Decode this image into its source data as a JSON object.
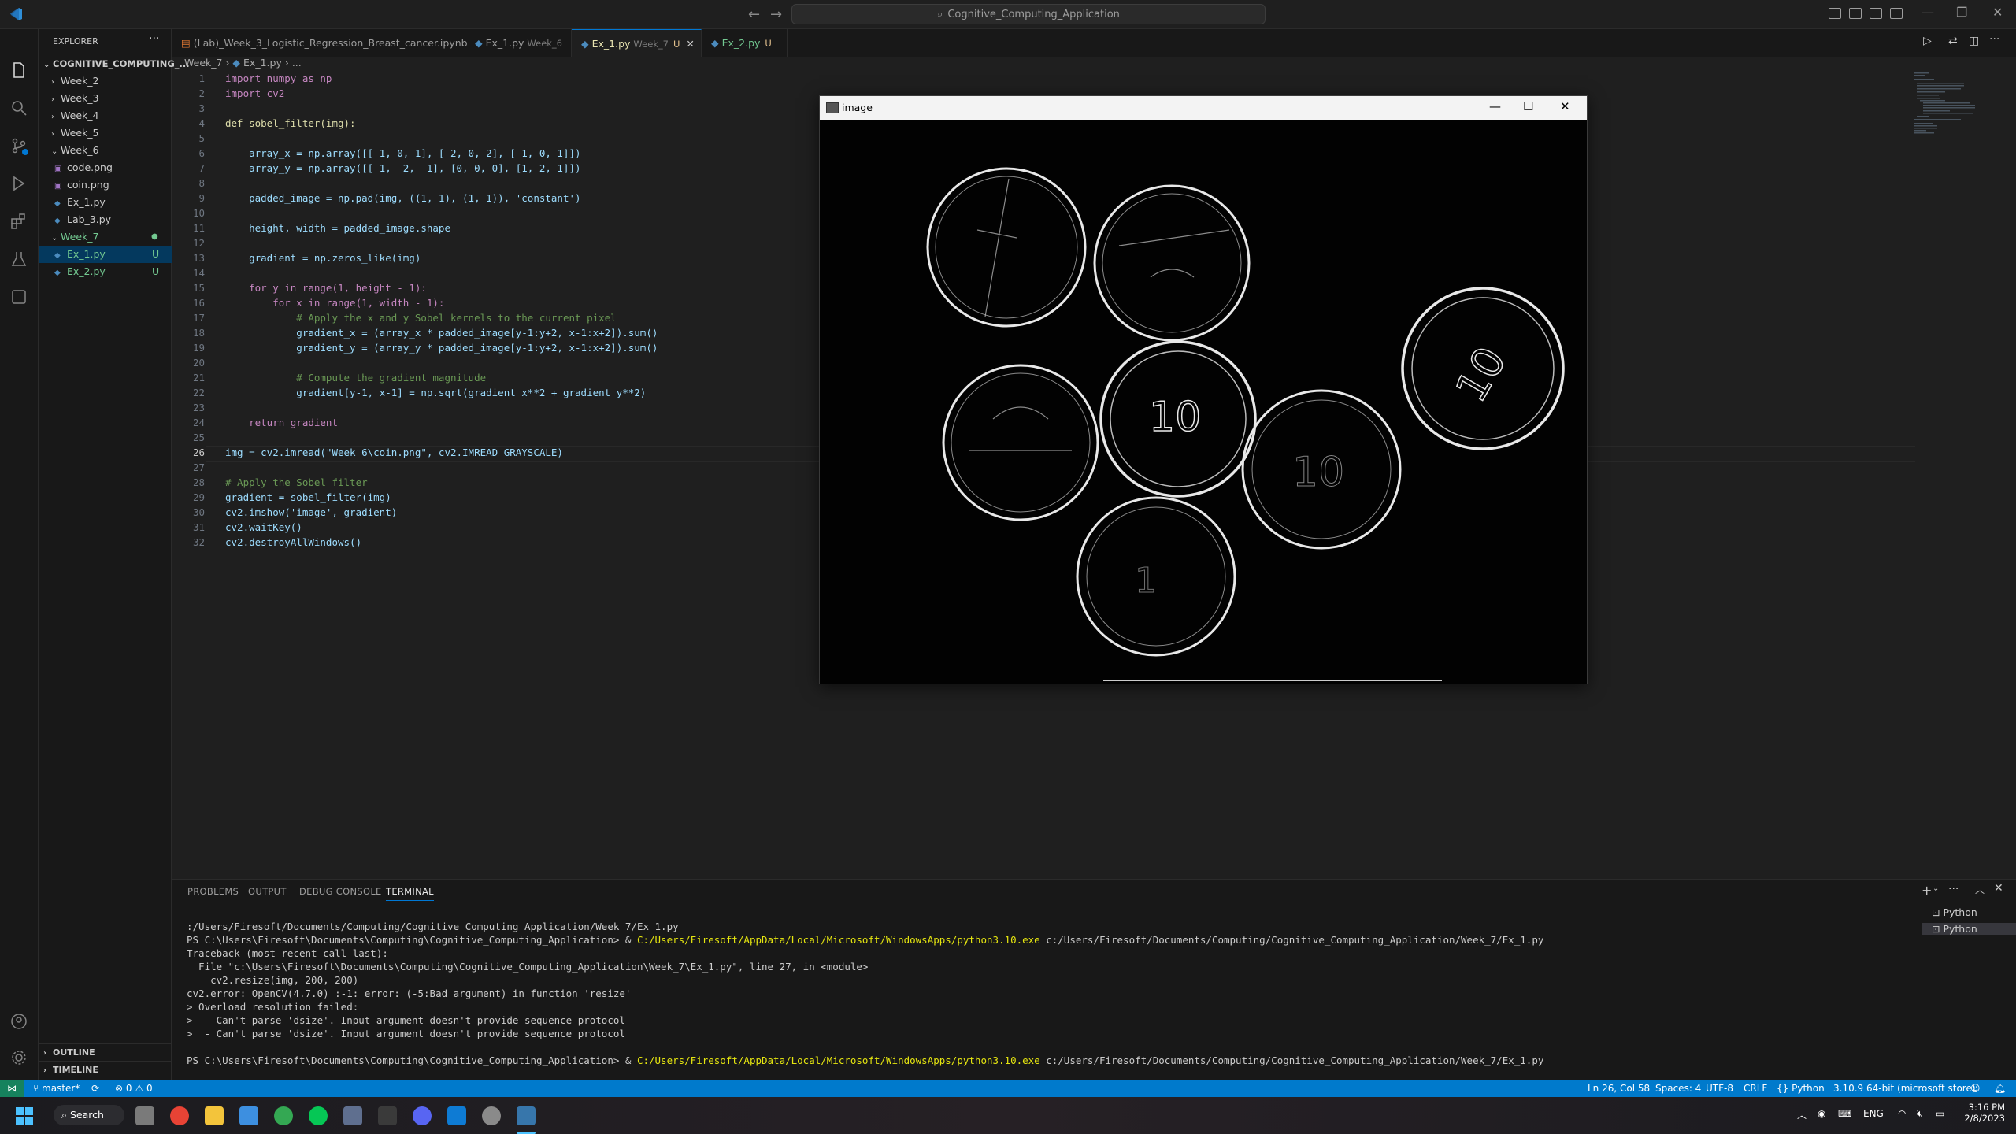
{
  "titlebar": {
    "search_text": "Cognitive_Computing_Application"
  },
  "sidebar": {
    "header": "EXPLORER",
    "root": "COGNITIVE_COMPUTING_...",
    "items": [
      {
        "label": "Week_2",
        "type": "folder"
      },
      {
        "label": "Week_3",
        "type": "folder"
      },
      {
        "label": "Week_4",
        "type": "folder"
      },
      {
        "label": "Week_5",
        "type": "folder"
      },
      {
        "label": "Week_6",
        "type": "folder-open"
      },
      {
        "label": "code.png",
        "type": "image"
      },
      {
        "label": "coin.png",
        "type": "image"
      },
      {
        "label": "Ex_1.py",
        "type": "python"
      },
      {
        "label": "Lab_3.py",
        "type": "python"
      },
      {
        "label": "Week_7",
        "type": "folder-open"
      },
      {
        "label": "Ex_1.py",
        "type": "python",
        "badge": "U"
      },
      {
        "label": "Ex_2.py",
        "type": "python",
        "badge": "U"
      }
    ],
    "outline": "OUTLINE",
    "timeline": "TIMELINE"
  },
  "tabs": [
    {
      "label": "(Lab)_Week_3_Logistic_Regression_Breast_cancer.ipynb",
      "desc": "",
      "mod": ""
    },
    {
      "label": "Ex_1.py",
      "desc": "Week_6",
      "mod": ""
    },
    {
      "label": "Ex_1.py",
      "desc": "Week_7",
      "mod": "U"
    },
    {
      "label": "Ex_2.py",
      "desc": "",
      "mod": "U"
    }
  ],
  "breadcrumb": {
    "folder": "Week_7",
    "file": "Ex_1.py",
    "rest": "..."
  },
  "code": [
    {
      "n": "1",
      "t": "import numpy as np"
    },
    {
      "n": "2",
      "t": "import cv2"
    },
    {
      "n": "3",
      "t": ""
    },
    {
      "n": "4",
      "t": "def sobel_filter(img):"
    },
    {
      "n": "5",
      "t": ""
    },
    {
      "n": "6",
      "t": "    array_x = np.array([[-1, 0, 1], [-2, 0, 2], [-1, 0, 1]])"
    },
    {
      "n": "7",
      "t": "    array_y = np.array([[-1, -2, -1], [0, 0, 0], [1, 2, 1]])"
    },
    {
      "n": "8",
      "t": ""
    },
    {
      "n": "9",
      "t": "    padded_image = np.pad(img, ((1, 1), (1, 1)), 'constant')"
    },
    {
      "n": "10",
      "t": ""
    },
    {
      "n": "11",
      "t": "    height, width = padded_image.shape"
    },
    {
      "n": "12",
      "t": ""
    },
    {
      "n": "13",
      "t": "    gradient = np.zeros_like(img)"
    },
    {
      "n": "14",
      "t": ""
    },
    {
      "n": "15",
      "t": "    for y in range(1, height - 1):"
    },
    {
      "n": "16",
      "t": "        for x in range(1, width - 1):"
    },
    {
      "n": "17",
      "t": "            # Apply the x and y Sobel kernels to the current pixel"
    },
    {
      "n": "18",
      "t": "            gradient_x = (array_x * padded_image[y-1:y+2, x-1:x+2]).sum()"
    },
    {
      "n": "19",
      "t": "            gradient_y = (array_y * padded_image[y-1:y+2, x-1:x+2]).sum()"
    },
    {
      "n": "20",
      "t": ""
    },
    {
      "n": "21",
      "t": "            # Compute the gradient magnitude"
    },
    {
      "n": "22",
      "t": "            gradient[y-1, x-1] = np.sqrt(gradient_x**2 + gradient_y**2)"
    },
    {
      "n": "23",
      "t": ""
    },
    {
      "n": "24",
      "t": "    return gradient"
    },
    {
      "n": "25",
      "t": ""
    },
    {
      "n": "26",
      "t": "img = cv2.imread(\"Week_6\\coin.png\", cv2.IMREAD_GRAYSCALE)"
    },
    {
      "n": "27",
      "t": ""
    },
    {
      "n": "28",
      "t": "# Apply the Sobel filter"
    },
    {
      "n": "29",
      "t": "gradient = sobel_filter(img)"
    },
    {
      "n": "30",
      "t": "cv2.imshow('image', gradient)"
    },
    {
      "n": "31",
      "t": "cv2.waitKey()"
    },
    {
      "n": "32",
      "t": "cv2.destroyAllWindows()"
    }
  ],
  "image_window": {
    "title": "image"
  },
  "panel": {
    "tabs": [
      "PROBLEMS",
      "OUTPUT",
      "DEBUG CONSOLE",
      "TERMINAL"
    ],
    "terminal_lines": [
      {
        "plain": ":/Users/Firesoft/Documents/Computing/Cognitive_Computing_Application/Week_7/Ex_1.py",
        "y": "",
        "rest": ""
      },
      {
        "plain": "PS C:\\Users\\Firesoft\\Documents\\Computing\\Cognitive_Computing_Application> & ",
        "y": "C:/Users/Firesoft/AppData/Local/Microsoft/WindowsApps/python3.10.exe",
        "rest": " c:/Users/Firesoft/Documents/Computing/Cognitive_Computing_Application/Week_7/Ex_1.py"
      },
      {
        "plain": "Traceback (most recent call last):",
        "y": "",
        "rest": ""
      },
      {
        "plain": "  File \"c:\\Users\\Firesoft\\Documents\\Computing\\Cognitive_Computing_Application\\Week_7\\Ex_1.py\", line 27, in <module>",
        "y": "",
        "rest": ""
      },
      {
        "plain": "    cv2.resize(img, 200, 200)",
        "y": "",
        "rest": ""
      },
      {
        "plain": "cv2.error: OpenCV(4.7.0) :-1: error: (-5:Bad argument) in function 'resize'",
        "y": "",
        "rest": ""
      },
      {
        "plain": "> Overload resolution failed:",
        "y": "",
        "rest": ""
      },
      {
        "plain": ">  - Can't parse 'dsize'. Input argument doesn't provide sequence protocol",
        "y": "",
        "rest": ""
      },
      {
        "plain": ">  - Can't parse 'dsize'. Input argument doesn't provide sequence protocol",
        "y": "",
        "rest": ""
      },
      {
        "plain": "",
        "y": "",
        "rest": ""
      },
      {
        "plain": "PS C:\\Users\\Firesoft\\Documents\\Computing\\Cognitive_Computing_Application> & ",
        "y": "C:/Users/Firesoft/AppData/Local/Microsoft/WindowsApps/python3.10.exe",
        "rest": " c:/Users/Firesoft/Documents/Computing/Cognitive_Computing_Application/Week_7/Ex_1.py"
      }
    ],
    "terminals": [
      "Python",
      "Python"
    ]
  },
  "statusbar": {
    "branch": "master*",
    "problems": "0",
    "warnings": "0",
    "position": "Ln 26, Col 58",
    "spaces": "Spaces: 4",
    "encoding": "UTF-8",
    "eol": "CRLF",
    "language": "Python",
    "interpreter": "3.10.9 64-bit (microsoft store)"
  },
  "taskbar": {
    "search": "Search",
    "lang": "ENG",
    "time": "3:16 PM",
    "date": "2/8/2023"
  },
  "colors": {
    "accent": "#0078d4",
    "statusbar": "#007acc"
  }
}
